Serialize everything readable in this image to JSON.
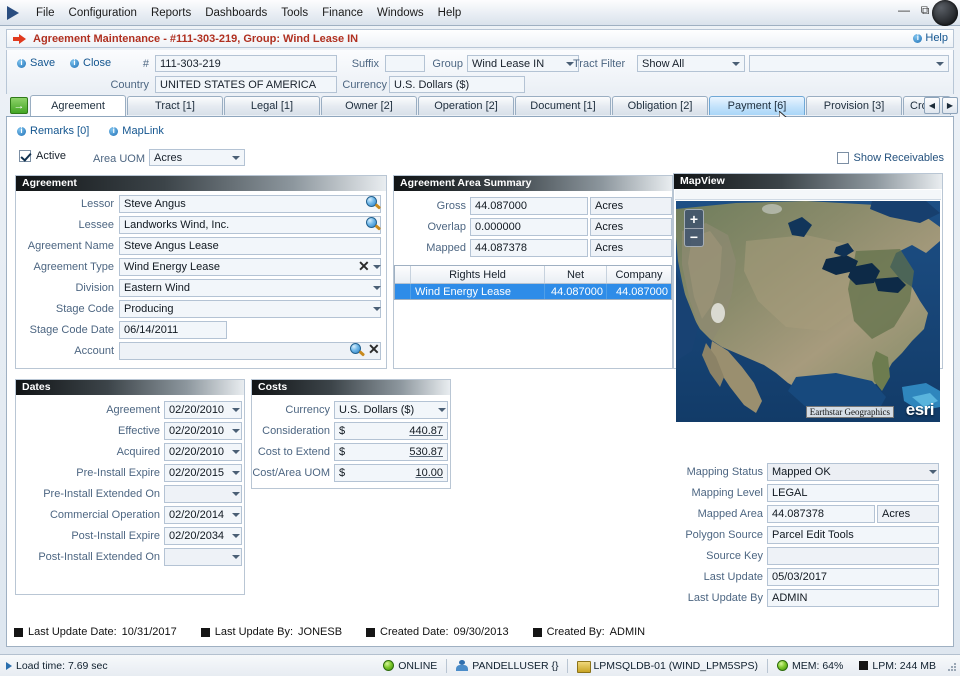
{
  "window": {
    "menu": [
      "File",
      "Configuration",
      "Reports",
      "Dashboards",
      "Tools",
      "Finance",
      "Windows",
      "Help"
    ],
    "minimize": "—",
    "restore": "⧉",
    "close": "✕"
  },
  "document_header": {
    "title": "Agreement Maintenance - #111-303-219, Group: Wind Lease IN",
    "help_label": "Help"
  },
  "toolbar": {
    "save_label": "Save",
    "close_label": "Close",
    "number_label": "#",
    "number_value": "111-303-219",
    "country_label": "Country",
    "country_value": "UNITED STATES OF AMERICA",
    "suffix_label": "Suffix",
    "suffix_value": "",
    "group_label": "Group",
    "group_value": "Wind Lease IN",
    "currency_label": "Currency",
    "currency_value": "U.S. Dollars ($)",
    "tract_filter_label": "Tract Filter",
    "tract_filter_value": "Show All",
    "tract_filter_secondary_value": ""
  },
  "tabs": {
    "go_icon": "go-arrow-icon",
    "items": [
      {
        "label": "Agreement",
        "state": "active"
      },
      {
        "label": "Tract [1]",
        "state": "normal"
      },
      {
        "label": "Legal [1]",
        "state": "normal"
      },
      {
        "label": "Owner [2]",
        "state": "normal"
      },
      {
        "label": "Operation [2]",
        "state": "normal"
      },
      {
        "label": "Document [1]",
        "state": "normal"
      },
      {
        "label": "Obligation [2]",
        "state": "normal"
      },
      {
        "label": "Payment [6]",
        "state": "hover"
      },
      {
        "label": "Provision [3]",
        "state": "normal"
      },
      {
        "label": "Cro",
        "state": "clipped"
      }
    ],
    "scroll_prev": "◀",
    "scroll_next": "▶"
  },
  "page": {
    "remarks_label": "Remarks [0]",
    "maplink_label": "MapLink",
    "active_label": "Active",
    "active_checked": true,
    "area_uom_label": "Area UOM",
    "area_uom_value": "Acres",
    "show_receivables_label": "Show Receivables",
    "show_receivables_checked": false
  },
  "agreement_panel": {
    "title": "Agreement",
    "fields": [
      {
        "label": "Lessor",
        "value": "Steve Angus",
        "control": "lookup"
      },
      {
        "label": "Lessee",
        "value": "Landworks Wind, Inc.",
        "control": "lookup"
      },
      {
        "label": "Agreement Name",
        "value": "Steve Angus Lease",
        "control": "text"
      },
      {
        "label": "Agreement Type",
        "value": "Wind Energy Lease",
        "control": "combo-clear"
      },
      {
        "label": "Division",
        "value": "Eastern Wind",
        "control": "combo"
      },
      {
        "label": "Stage Code",
        "value": "Producing",
        "control": "combo"
      },
      {
        "label": "Stage Code Date",
        "value": "06/14/2011",
        "control": "date"
      },
      {
        "label": "Account",
        "value": "",
        "control": "lookup-clear"
      }
    ]
  },
  "area_summary_panel": {
    "title": "Agreement Area Summary",
    "rows": [
      {
        "label": "Gross",
        "value": "44.087000",
        "uom": "Acres"
      },
      {
        "label": "Overlap",
        "value": "0.000000",
        "uom": "Acres"
      },
      {
        "label": "Mapped",
        "value": "44.087378",
        "uom": "Acres"
      }
    ],
    "grid": {
      "columns": [
        "",
        "Rights Held",
        "Net",
        "Company"
      ],
      "rows": [
        {
          "cells": [
            "",
            "Wind Energy Lease",
            "44.087000",
            "44.087000"
          ],
          "selected": true
        }
      ]
    }
  },
  "dates_panel": {
    "title": "Dates",
    "fields": [
      {
        "label": "Agreement",
        "value": "02/20/2010"
      },
      {
        "label": "Effective",
        "value": "02/20/2010"
      },
      {
        "label": "Acquired",
        "value": "02/20/2010"
      },
      {
        "label": "Pre-Install Expire",
        "value": "02/20/2015"
      },
      {
        "label": "Pre-Install Extended On",
        "value": ""
      },
      {
        "label": "Commercial Operation",
        "value": "02/20/2014"
      },
      {
        "label": "Post-Install Expire",
        "value": "02/20/2034"
      },
      {
        "label": "Post-Install Extended On",
        "value": ""
      }
    ]
  },
  "costs_panel": {
    "title": "Costs",
    "currency_label": "Currency",
    "currency_value": "U.S. Dollars ($)",
    "fields": [
      {
        "label": "Consideration",
        "prefix": "$",
        "value": "440.87"
      },
      {
        "label": "Cost to Extend",
        "prefix": "$",
        "value": "530.87"
      },
      {
        "label": "Cost/Area UOM",
        "prefix": "$",
        "value": "10.00"
      }
    ]
  },
  "mapview_panel": {
    "title": "MapView",
    "zoom_in": "+",
    "zoom_out": "−",
    "attribution": "Earthstar Geographics",
    "provider": "esri",
    "fields": [
      {
        "label": "Mapping Status",
        "value": "Mapped OK",
        "control": "combo"
      },
      {
        "label": "Mapping Level",
        "value": "LEGAL",
        "control": "text"
      },
      {
        "label": "Mapped Area",
        "value": "44.087378",
        "uom": "Acres",
        "control": "text"
      },
      {
        "label": "Polygon Source",
        "value": "Parcel Edit Tools",
        "control": "text"
      },
      {
        "label": "Source Key",
        "value": "",
        "control": "text"
      },
      {
        "label": "Last Update",
        "value": "05/03/2017",
        "control": "text"
      },
      {
        "label": "Last Update By",
        "value": "ADMIN",
        "control": "text"
      }
    ]
  },
  "audit": [
    {
      "label": "Last Update Date:",
      "value": "10/31/2017"
    },
    {
      "label": "Last Update By:",
      "value": "JONESB"
    },
    {
      "label": "Created Date:",
      "value": "09/30/2013"
    },
    {
      "label": "Created By:",
      "value": "ADMIN"
    }
  ],
  "statusbar": {
    "load_time": "Load time: 7.69 sec",
    "online": "ONLINE",
    "user": "PANDELLUSER {}",
    "database": "LPMSQLDB-01 (WIND_LPM5SPS)",
    "memory": "MEM: 64%",
    "lpm": "LPM: 244 MB"
  }
}
